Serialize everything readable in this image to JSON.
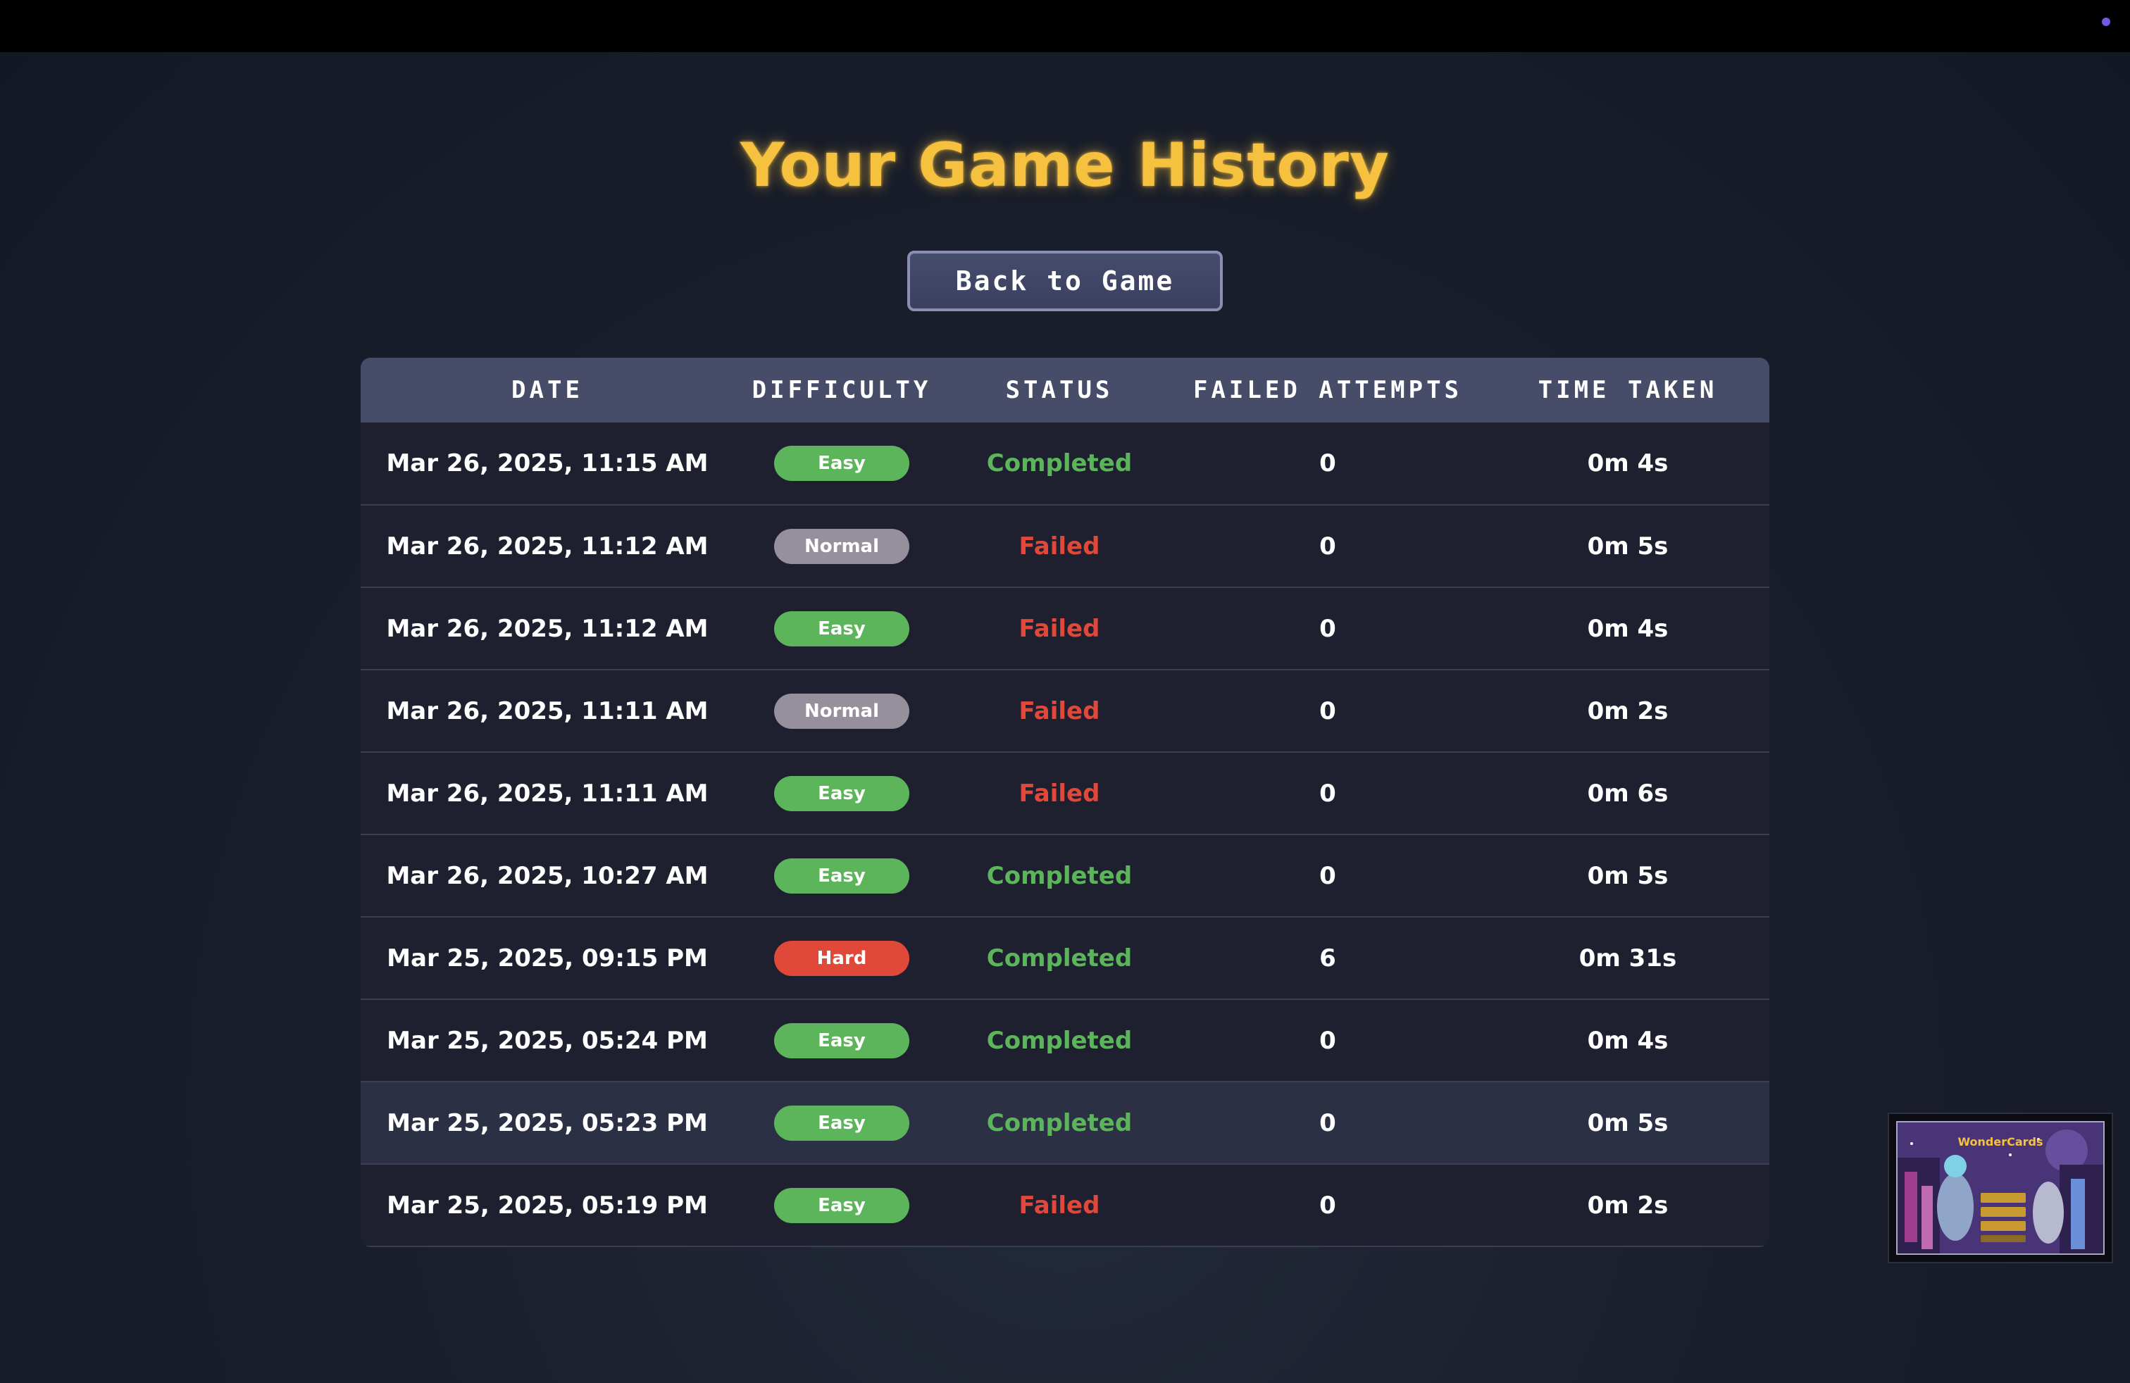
{
  "page": {
    "title": "Your Game History",
    "back_button_label": "Back to Game"
  },
  "colors": {
    "title": "#f6c13f",
    "easy": "#5cb55a",
    "normal": "#968f9c",
    "hard": "#e0483a",
    "completed": "#5cb55a",
    "failed": "#e0483a"
  },
  "table": {
    "headers": [
      "DATE",
      "DIFFICULTY",
      "STATUS",
      "FAILED ATTEMPTS",
      "TIME TAKEN"
    ],
    "rows": [
      {
        "date": "Mar 26, 2025, 11:15 AM",
        "difficulty": "Easy",
        "status": "Completed",
        "failed_attempts": "0",
        "time_taken": "0m 4s"
      },
      {
        "date": "Mar 26, 2025, 11:12 AM",
        "difficulty": "Normal",
        "status": "Failed",
        "failed_attempts": "0",
        "time_taken": "0m 5s"
      },
      {
        "date": "Mar 26, 2025, 11:12 AM",
        "difficulty": "Easy",
        "status": "Failed",
        "failed_attempts": "0",
        "time_taken": "0m 4s"
      },
      {
        "date": "Mar 26, 2025, 11:11 AM",
        "difficulty": "Normal",
        "status": "Failed",
        "failed_attempts": "0",
        "time_taken": "0m 2s"
      },
      {
        "date": "Mar 26, 2025, 11:11 AM",
        "difficulty": "Easy",
        "status": "Failed",
        "failed_attempts": "0",
        "time_taken": "0m 6s"
      },
      {
        "date": "Mar 26, 2025, 10:27 AM",
        "difficulty": "Easy",
        "status": "Completed",
        "failed_attempts": "0",
        "time_taken": "0m 5s"
      },
      {
        "date": "Mar 25, 2025, 09:15 PM",
        "difficulty": "Hard",
        "status": "Completed",
        "failed_attempts": "6",
        "time_taken": "0m 31s"
      },
      {
        "date": "Mar 25, 2025, 05:24 PM",
        "difficulty": "Easy",
        "status": "Completed",
        "failed_attempts": "0",
        "time_taken": "0m 4s"
      },
      {
        "date": "Mar 25, 2025, 05:23 PM",
        "difficulty": "Easy",
        "status": "Completed",
        "failed_attempts": "0",
        "time_taken": "0m 5s"
      },
      {
        "date": "Mar 25, 2025, 05:19 PM",
        "difficulty": "Easy",
        "status": "Failed",
        "failed_attempts": "0",
        "time_taken": "0m 2s"
      }
    ]
  },
  "thumbnail": {
    "title": "WonderCards"
  }
}
